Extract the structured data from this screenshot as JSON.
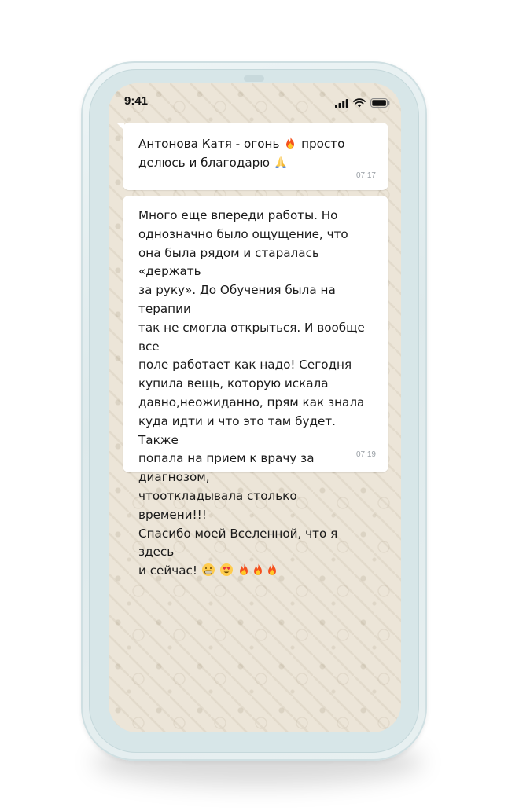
{
  "status_bar": {
    "time": "9:41",
    "icons": [
      "signal-bars-icon",
      "wifi-icon",
      "battery-icon"
    ]
  },
  "messages": [
    {
      "text_lines": [
        "Антонова Катя - огонь ",
        " просто",
        "делюсь и благодарю "
      ],
      "emojis": [
        "fire-emoji",
        "folded-hands-emoji"
      ],
      "time": "07:17"
    },
    {
      "text": "Много еще впереди работы. Но\nоднозначно было ощущение, что\nона была рядом и старалась «держать\nза руку». До Обучения была на терапии\nтак не смогла открыться. И вообще все\nполе работает как надо! Сегодня\nкупила вещь, которую искала\nдавно,неожиданно, прям как знала\nкуда идти и что это там будет. Также\nпопала на прием к врачу за диагнозом,\nчтооткладывала столько времени!!!\nСпасибо моей Вселенной, что я здесь\nи сейчас! ",
      "emojis": [
        "grinning-emoji",
        "heart-eyes-emoji",
        "fire-emoji",
        "fire-emoji",
        "fire-emoji"
      ],
      "time": "07:19"
    }
  ],
  "colors": {
    "chat_background": "#ece5d8",
    "bubble": "#ffffff",
    "frame": "#dde9eb",
    "timestamp": "#9aa0a6"
  }
}
